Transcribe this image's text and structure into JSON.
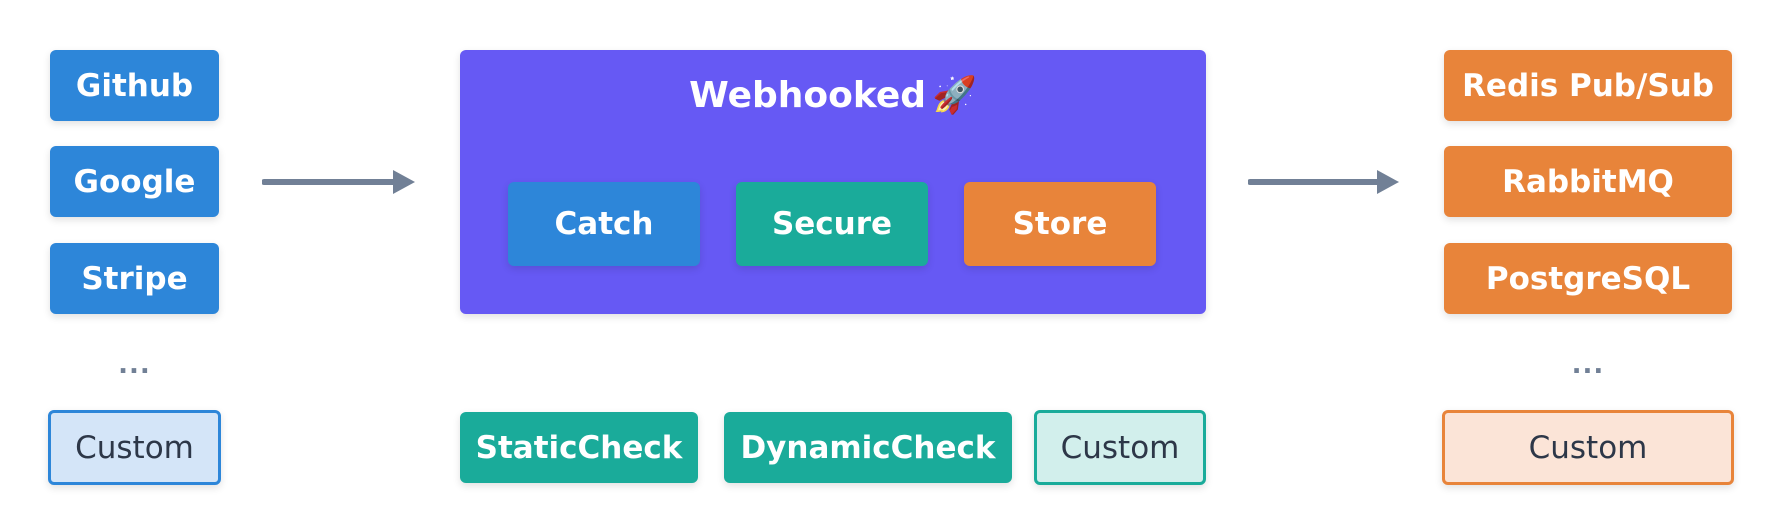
{
  "sources": {
    "items": [
      "Github",
      "Google",
      "Stripe"
    ],
    "ellipsis": "...",
    "custom": "Custom"
  },
  "core": {
    "title": "Webhooked",
    "icon": "rocket-icon",
    "title_icon_glyph": "🚀",
    "stages": [
      "Catch",
      "Secure",
      "Store"
    ]
  },
  "security": {
    "items": [
      "StaticCheck",
      "DynamicCheck"
    ],
    "custom": "Custom"
  },
  "storages": {
    "items": [
      "Redis Pub/Sub",
      "RabbitMQ",
      "PostgreSQL"
    ],
    "ellipsis": "...",
    "custom": "Custom"
  },
  "colors": {
    "source_blue": "#2d86d9",
    "security_teal": "#1aab9a",
    "storage_orange": "#e8843a",
    "core_purple": "#6659f4",
    "arrow_gray": "#718096"
  }
}
